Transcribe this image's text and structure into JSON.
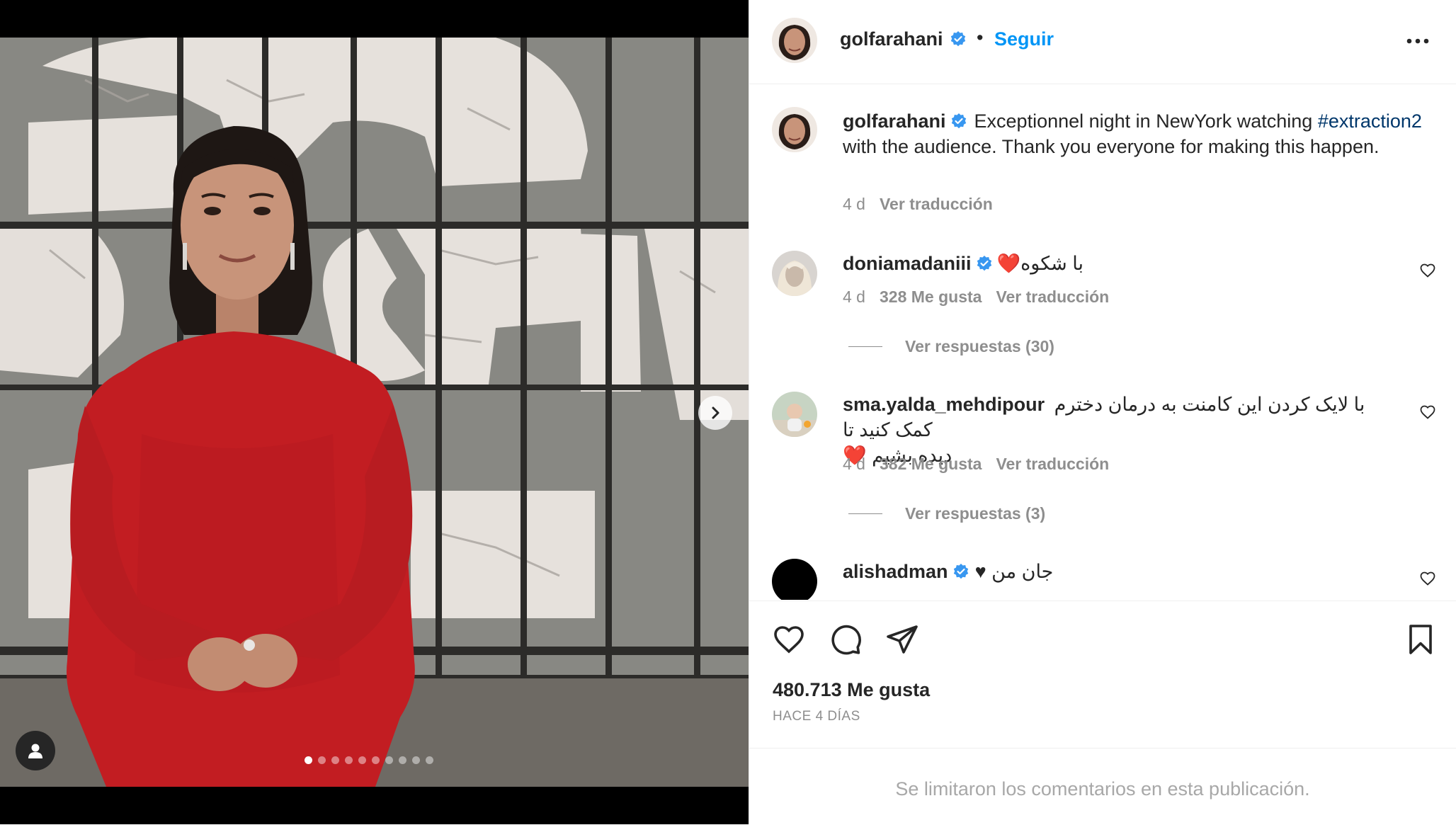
{
  "post": {
    "author": "golfarahani",
    "bullet": "•",
    "follow_label": "Seguir",
    "caption": {
      "username": "golfarahani",
      "text_before": "Exceptionnel night in NewYork watching",
      "hashtag": "#extraction2",
      "text_after": "with the audience. Thank you everyone for making this happen.",
      "time": "4 d",
      "translate": "Ver traducción"
    },
    "likes": "480.713 Me gusta",
    "time_ago": "HACE 4 DÍAS",
    "comments_limited": "Se limitaron los comentarios en esta publicación.",
    "media": {
      "slide_count": 10,
      "active_slide": 0
    }
  },
  "comments": [
    {
      "username": "doniamadaniii",
      "text": "با شکوه",
      "emoji": "❤️",
      "time": "4 d",
      "likes": "328 Me gusta",
      "translate": "Ver traducción",
      "replies": "Ver respuestas (30)"
    },
    {
      "username": "sma.yalda_mehdipour",
      "text_line1": "با لایک کردن این کامنت به درمان دخترم کمک کنید تا",
      "text_line2": "دیده بشیم",
      "emoji": "❤️",
      "time": "4 d",
      "likes": "382 Me gusta",
      "translate": "Ver traducción",
      "replies": "Ver respuestas (3)"
    },
    {
      "username": "alishadman",
      "text": "جان من",
      "emoji": "♥"
    }
  ],
  "colors": {
    "accent": "#0095f6",
    "verified": "#3897f0",
    "hashtag": "#00376b",
    "dress": "#c21d22"
  },
  "icons": [
    "more-icon",
    "verified-icon",
    "heart-icon",
    "comment-icon",
    "share-icon",
    "bookmark-icon",
    "chevron-right-icon",
    "user-tag-icon"
  ]
}
